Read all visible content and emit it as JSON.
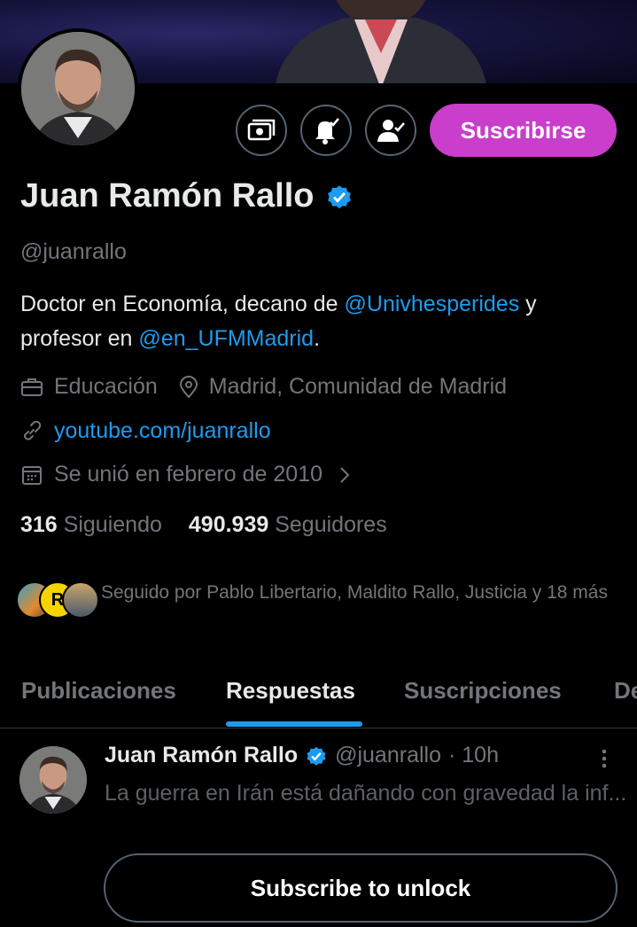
{
  "profile": {
    "name": "Juan Ramón Rallo",
    "handle": "@juanrallo",
    "subscribe_label": "Suscribirse",
    "bio": {
      "part1": "Doctor en Economía, decano de ",
      "mention1": "@Univhesperides",
      "part2": " y profesor en ",
      "mention2": "@en_UFMMadrid",
      "part3": "."
    },
    "category": "Educación",
    "location": "Madrid, Comunidad de Madrid",
    "website": "youtube.com/juanrallo",
    "joined": "Se unió en febrero de 2010",
    "following_count": "316",
    "following_label": "Siguiendo",
    "followers_count": "490.939",
    "followers_label": "Seguidores",
    "followed_by": "Seguido por Pablo Libertario, Maldito Rallo, Justicia y 18 más",
    "mini_avatar_letter": "R"
  },
  "tabs": [
    {
      "label": "Publicaciones",
      "active": false
    },
    {
      "label": "Respuestas",
      "active": true
    },
    {
      "label": "Suscripciones",
      "active": false
    },
    {
      "label": "De",
      "active": false
    }
  ],
  "post": {
    "author": "Juan Ramón Rallo",
    "handle": "@juanrallo",
    "time": "· 10h",
    "text": "La guerra en Irán está dañando con gravedad la inf...",
    "unlock_label": "Subscribe to unlock"
  },
  "colors": {
    "accent": "#1d9bf0",
    "subscribe": "#c93ecb",
    "muted": "#71767b"
  }
}
